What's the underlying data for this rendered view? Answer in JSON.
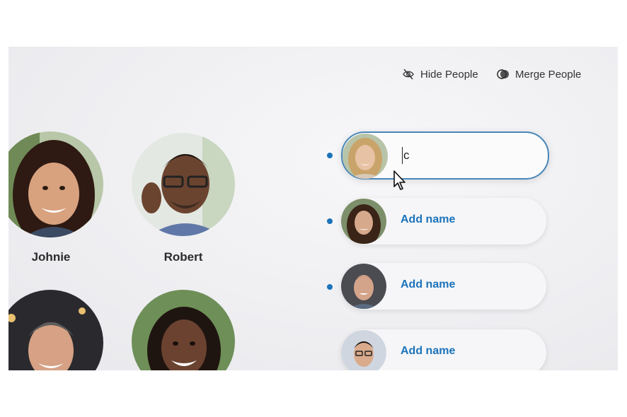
{
  "toolbar": {
    "hide_label": "Hide People",
    "merge_label": "Merge People"
  },
  "people": [
    {
      "name": "Johnie"
    },
    {
      "name": "Robert"
    },
    {
      "name": ""
    },
    {
      "name": ""
    }
  ],
  "naming_rows": [
    {
      "value": "c",
      "placeholder": "Add name",
      "active": true,
      "unread_dot": true
    },
    {
      "label": "Add name",
      "unread_dot": true
    },
    {
      "label": "Add name",
      "unread_dot": true
    },
    {
      "label": "Add name",
      "unread_dot": false
    }
  ],
  "colors": {
    "accent": "#1b73ba",
    "active_border": "#4a87b8",
    "text": "#2b2b2b"
  },
  "icons": [
    "hide-people-icon",
    "merge-people-icon",
    "mouse-pointer-icon"
  ]
}
